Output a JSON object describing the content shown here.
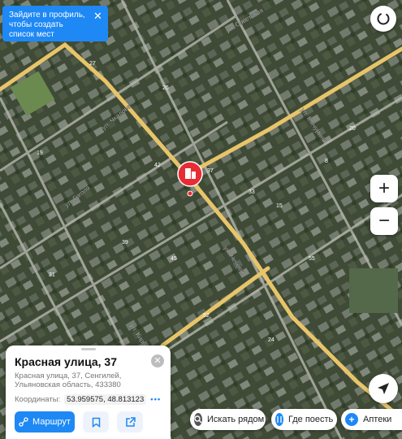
{
  "banner": {
    "text": "Зайдите в профиль, чтобы создать список мест"
  },
  "map": {
    "street_labels": [
      "ул. Чехова",
      "ул. Чкалова",
      "ул. Гоголя",
      "ул. Мичурина",
      "ул. Кирова",
      "ул. Советская"
    ],
    "house_numbers": [
      "37",
      "33",
      "42",
      "15",
      "39",
      "45",
      "8",
      "31",
      "20",
      "52",
      "27",
      "24",
      "55",
      "19",
      "26"
    ],
    "colors": {
      "accent": "#1e88f5",
      "pin": "#e82c33",
      "road": "#e8c46a"
    }
  },
  "card": {
    "title": "Красная улица, 37",
    "address": "Красная улица, 37, Сенгилей, Ульяновская область, 433380",
    "coords_label": "Координаты:",
    "coords_value": "53.959575, 48.813123",
    "more": "•••",
    "route_label": "Маршрут"
  },
  "chips": {
    "search_nearby": "Искать рядом",
    "where_to_eat": "Где поесть",
    "pharmacies": "Аптеки"
  },
  "controls": {
    "zoom_in": "+",
    "zoom_out": "−"
  }
}
